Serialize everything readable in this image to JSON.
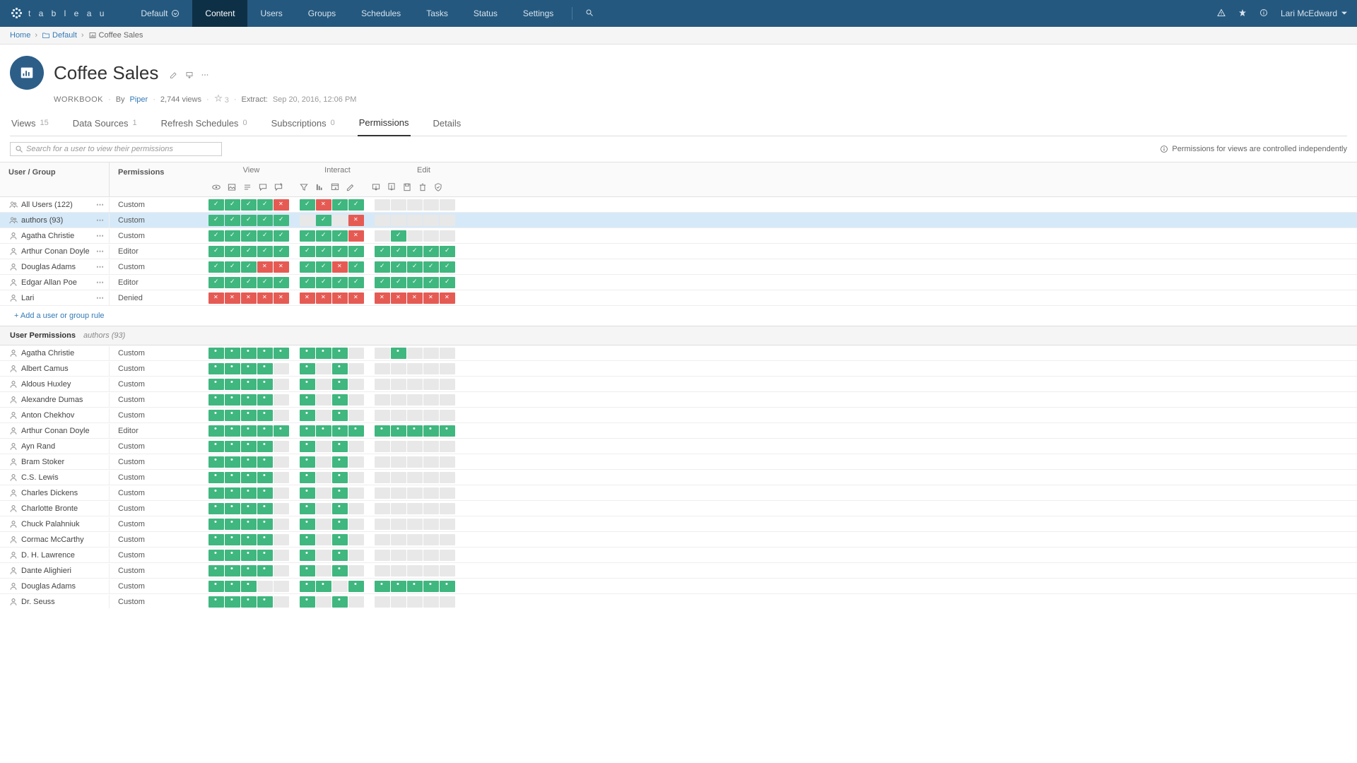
{
  "brand": "t a b l e a u",
  "site_name": "Default",
  "nav": [
    "Content",
    "Users",
    "Groups",
    "Schedules",
    "Tasks",
    "Status",
    "Settings"
  ],
  "nav_active": 0,
  "current_user": "Lari McEdward",
  "breadcrumbs": [
    {
      "label": "Home",
      "icon": null
    },
    {
      "label": "Default",
      "icon": "folder"
    },
    {
      "label": "Coffee Sales",
      "icon": "workbook"
    }
  ],
  "workbook": {
    "title": "Coffee Sales",
    "type_label": "WORKBOOK",
    "by_label": "By",
    "owner": "Piper",
    "views": "2,744 views",
    "fav_count": "3",
    "extract_label": "Extract:",
    "extract_time": "Sep 20, 2016, 12:06 PM"
  },
  "tabs": [
    {
      "label": "Views",
      "count": "15"
    },
    {
      "label": "Data Sources",
      "count": "1"
    },
    {
      "label": "Refresh Schedules",
      "count": "0"
    },
    {
      "label": "Subscriptions",
      "count": "0"
    },
    {
      "label": "Permissions",
      "count": ""
    },
    {
      "label": "Details",
      "count": ""
    }
  ],
  "tab_active": 4,
  "search_placeholder": "Search for a user to view their permissions",
  "notice": "Permissions for views are controlled independently",
  "headers": {
    "user_group": "User / Group",
    "permissions": "Permissions",
    "view": "View",
    "interact": "Interact",
    "edit": "Edit"
  },
  "cap_icons": {
    "view": [
      "eye",
      "image",
      "summary",
      "comment",
      "comment-add"
    ],
    "interact": [
      "filter",
      "sort",
      "webedit",
      "pencil"
    ],
    "edit": [
      "download",
      "download2",
      "save",
      "trash",
      "shield"
    ]
  },
  "rules": [
    {
      "name": "All Users (122)",
      "type": "group",
      "role": "Custom",
      "view": [
        "A",
        "A",
        "A",
        "A",
        "D"
      ],
      "interact": [
        "A",
        "D",
        "A",
        "A"
      ],
      "edit": [
        "U",
        "U",
        "U",
        "U",
        "U"
      ]
    },
    {
      "name": "authors (93)",
      "type": "group",
      "role": "Custom",
      "selected": true,
      "view": [
        "A",
        "A",
        "A",
        "A",
        "A"
      ],
      "interact": [
        "U",
        "A",
        "U",
        "D"
      ],
      "edit": [
        "U",
        "U",
        "U",
        "U",
        "U"
      ]
    },
    {
      "name": "Agatha Christie",
      "type": "user",
      "role": "Custom",
      "view": [
        "A",
        "A",
        "A",
        "A",
        "A"
      ],
      "interact": [
        "A",
        "A",
        "A",
        "D"
      ],
      "edit": [
        "U",
        "A",
        "U",
        "U",
        "U"
      ]
    },
    {
      "name": "Arthur Conan Doyle",
      "type": "user",
      "role": "Editor",
      "view": [
        "A",
        "A",
        "A",
        "A",
        "A"
      ],
      "interact": [
        "A",
        "A",
        "A",
        "A"
      ],
      "edit": [
        "A",
        "A",
        "A",
        "A",
        "A"
      ]
    },
    {
      "name": "Douglas Adams",
      "type": "user",
      "role": "Custom",
      "view": [
        "A",
        "A",
        "A",
        "D",
        "D"
      ],
      "interact": [
        "A",
        "A",
        "D",
        "A"
      ],
      "edit": [
        "A",
        "A",
        "A",
        "A",
        "A"
      ]
    },
    {
      "name": "Edgar Allan Poe",
      "type": "user",
      "role": "Editor",
      "view": [
        "A",
        "A",
        "A",
        "A",
        "A"
      ],
      "interact": [
        "A",
        "A",
        "A",
        "A"
      ],
      "edit": [
        "A",
        "A",
        "A",
        "A",
        "A"
      ]
    },
    {
      "name": "Lari",
      "type": "user",
      "role": "Denied",
      "view": [
        "D",
        "D",
        "D",
        "D",
        "D"
      ],
      "interact": [
        "D",
        "D",
        "D",
        "D"
      ],
      "edit": [
        "D",
        "D",
        "D",
        "D",
        "D"
      ]
    }
  ],
  "add_rule_label": "+ Add a user or group rule",
  "user_perm_title": "User Permissions",
  "user_perm_sub": "authors (93)",
  "effective": [
    {
      "name": "Agatha Christie",
      "role": "Custom",
      "view": [
        "Ad",
        "Ad",
        "Ad",
        "Ad",
        "Ad"
      ],
      "interact": [
        "Ad",
        "Ad",
        "Ad",
        "Ud"
      ],
      "edit": [
        "Ud",
        "Ad",
        "Ud",
        "Ud",
        "Ud"
      ]
    },
    {
      "name": "Albert Camus",
      "role": "Custom",
      "view": [
        "Ad",
        "Ad",
        "Ad",
        "Ad",
        "Ud"
      ],
      "interact": [
        "Ad",
        "Ud",
        "Ad",
        "Ud"
      ],
      "edit": [
        "Ud",
        "Ud",
        "Ud",
        "Ud",
        "Ud"
      ]
    },
    {
      "name": "Aldous Huxley",
      "role": "Custom",
      "view": [
        "Ad",
        "Ad",
        "Ad",
        "Ad",
        "Ud"
      ],
      "interact": [
        "Ad",
        "Ud",
        "Ad",
        "Ud"
      ],
      "edit": [
        "Ud",
        "Ud",
        "Ud",
        "Ud",
        "Ud"
      ]
    },
    {
      "name": "Alexandre Dumas",
      "role": "Custom",
      "view": [
        "Ad",
        "Ad",
        "Ad",
        "Ad",
        "Ud"
      ],
      "interact": [
        "Ad",
        "Ud",
        "Ad",
        "Ud"
      ],
      "edit": [
        "Ud",
        "Ud",
        "Ud",
        "Ud",
        "Ud"
      ]
    },
    {
      "name": "Anton Chekhov",
      "role": "Custom",
      "view": [
        "Ad",
        "Ad",
        "Ad",
        "Ad",
        "Ud"
      ],
      "interact": [
        "Ad",
        "Ud",
        "Ad",
        "Ud"
      ],
      "edit": [
        "Ud",
        "Ud",
        "Ud",
        "Ud",
        "Ud"
      ]
    },
    {
      "name": "Arthur Conan Doyle",
      "role": "Editor",
      "view": [
        "Ad",
        "Ad",
        "Ad",
        "Ad",
        "Ad"
      ],
      "interact": [
        "Ad",
        "Ad",
        "Ad",
        "Ad"
      ],
      "edit": [
        "Ad",
        "Ad",
        "Ad",
        "Ad",
        "Ad"
      ]
    },
    {
      "name": "Ayn Rand",
      "role": "Custom",
      "view": [
        "Ad",
        "Ad",
        "Ad",
        "Ad",
        "Ud"
      ],
      "interact": [
        "Ad",
        "Ud",
        "Ad",
        "Ud"
      ],
      "edit": [
        "Ud",
        "Ud",
        "Ud",
        "Ud",
        "Ud"
      ]
    },
    {
      "name": "Bram Stoker",
      "role": "Custom",
      "view": [
        "Ad",
        "Ad",
        "Ad",
        "Ad",
        "Ud"
      ],
      "interact": [
        "Ad",
        "Ud",
        "Ad",
        "Ud"
      ],
      "edit": [
        "Ud",
        "Ud",
        "Ud",
        "Ud",
        "Ud"
      ]
    },
    {
      "name": "C.S. Lewis",
      "role": "Custom",
      "view": [
        "Ad",
        "Ad",
        "Ad",
        "Ad",
        "Ud"
      ],
      "interact": [
        "Ad",
        "Ud",
        "Ad",
        "Ud"
      ],
      "edit": [
        "Ud",
        "Ud",
        "Ud",
        "Ud",
        "Ud"
      ]
    },
    {
      "name": "Charles Dickens",
      "role": "Custom",
      "view": [
        "Ad",
        "Ad",
        "Ad",
        "Ad",
        "Ud"
      ],
      "interact": [
        "Ad",
        "Ud",
        "Ad",
        "Ud"
      ],
      "edit": [
        "Ud",
        "Ud",
        "Ud",
        "Ud",
        "Ud"
      ]
    },
    {
      "name": "Charlotte Bronte",
      "role": "Custom",
      "view": [
        "Ad",
        "Ad",
        "Ad",
        "Ad",
        "Ud"
      ],
      "interact": [
        "Ad",
        "Ud",
        "Ad",
        "Ud"
      ],
      "edit": [
        "Ud",
        "Ud",
        "Ud",
        "Ud",
        "Ud"
      ]
    },
    {
      "name": "Chuck Palahniuk",
      "role": "Custom",
      "view": [
        "Ad",
        "Ad",
        "Ad",
        "Ad",
        "Ud"
      ],
      "interact": [
        "Ad",
        "Ud",
        "Ad",
        "Ud"
      ],
      "edit": [
        "Ud",
        "Ud",
        "Ud",
        "Ud",
        "Ud"
      ]
    },
    {
      "name": "Cormac McCarthy",
      "role": "Custom",
      "view": [
        "Ad",
        "Ad",
        "Ad",
        "Ad",
        "Ud"
      ],
      "interact": [
        "Ad",
        "Ud",
        "Ad",
        "Ud"
      ],
      "edit": [
        "Ud",
        "Ud",
        "Ud",
        "Ud",
        "Ud"
      ]
    },
    {
      "name": "D. H. Lawrence",
      "role": "Custom",
      "view": [
        "Ad",
        "Ad",
        "Ad",
        "Ad",
        "Ud"
      ],
      "interact": [
        "Ad",
        "Ud",
        "Ad",
        "Ud"
      ],
      "edit": [
        "Ud",
        "Ud",
        "Ud",
        "Ud",
        "Ud"
      ]
    },
    {
      "name": "Dante Alighieri",
      "role": "Custom",
      "view": [
        "Ad",
        "Ad",
        "Ad",
        "Ad",
        "Ud"
      ],
      "interact": [
        "Ad",
        "Ud",
        "Ad",
        "Ud"
      ],
      "edit": [
        "Ud",
        "Ud",
        "Ud",
        "Ud",
        "Ud"
      ]
    },
    {
      "name": "Douglas Adams",
      "role": "Custom",
      "view": [
        "Ad",
        "Ad",
        "Ad",
        "Ud",
        "Ud"
      ],
      "interact": [
        "Ad",
        "Ad",
        "Ud",
        "Ad"
      ],
      "edit": [
        "Ad",
        "Ad",
        "Ad",
        "Ad",
        "Ad"
      ]
    },
    {
      "name": "Dr. Seuss",
      "role": "Custom",
      "view": [
        "Ad",
        "Ad",
        "Ad",
        "Ad",
        "Ud"
      ],
      "interact": [
        "Ad",
        "Ud",
        "Ad",
        "Ud"
      ],
      "edit": [
        "Ud",
        "Ud",
        "Ud",
        "Ud",
        "Ud"
      ]
    }
  ]
}
